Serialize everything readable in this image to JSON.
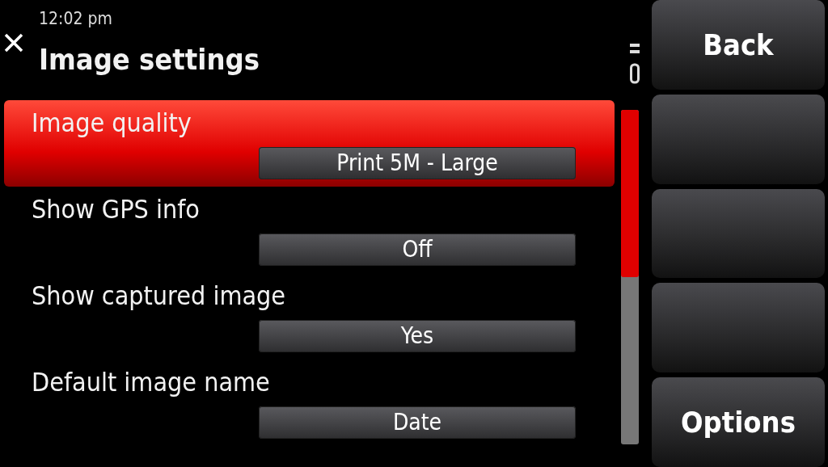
{
  "status_bar": {
    "time": "12:02 pm"
  },
  "header": {
    "title": "Image settings"
  },
  "settings": [
    {
      "label": "Image quality",
      "value": "Print 5M - Large",
      "selected": true
    },
    {
      "label": "Show GPS info",
      "value": "Off",
      "selected": false
    },
    {
      "label": "Show captured image",
      "value": "Yes",
      "selected": false
    },
    {
      "label": "Default image name",
      "value": "Date",
      "selected": false
    }
  ],
  "soft_keys": [
    {
      "label": "Back"
    },
    {
      "kind": "blank"
    },
    {
      "kind": "blank"
    },
    {
      "kind": "blank"
    },
    {
      "label": "Options"
    }
  ]
}
